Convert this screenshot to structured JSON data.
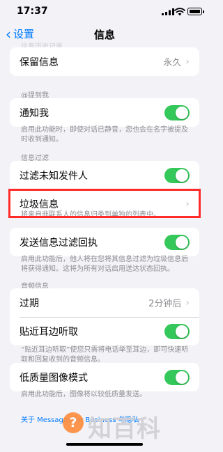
{
  "status": {
    "time": "17:37"
  },
  "nav": {
    "back": "设置",
    "title": "信息"
  },
  "top_cut_header": "信息历史记录",
  "history": {
    "keep": {
      "label": "保留信息",
      "value": "永久"
    }
  },
  "mentions": {
    "header": "@提到我",
    "notify": {
      "label": "通知我",
      "on": true
    },
    "note": "启用此功能时，即使对话已静音，您也会在名字被提及时收到通知。"
  },
  "filtering": {
    "header": "信息过滤",
    "unknown": {
      "label": "过滤未知发件人",
      "on": true
    },
    "junk": {
      "label": "垃圾信息"
    },
    "note": "将来自非联系人的信息归类到单独的列表中。"
  },
  "receipts": {
    "send": {
      "label": "发送信息过滤回执",
      "on": true
    },
    "note": "启用此功能后，他人将在您将其信息过滤为垃圾信息后将获得通知。这将为所有对话启用送达状态回执。"
  },
  "audio": {
    "header": "音频信息",
    "expire": {
      "label": "过期",
      "value": "2分钟后"
    },
    "raise": {
      "label": "贴近耳边听取",
      "on": true
    },
    "note": "“贴近耳边听取”使您只需将电话举至耳边，即可快速听取和回复收到的音频信息。"
  },
  "lowquality": {
    "label": "低质量图像模式",
    "on": true,
    "note": "启用此功能后，图像将以较低质量发送。"
  },
  "footer_link": "关于 Messages for Business 与隐私",
  "watermark": {
    "icon_char": "?",
    "text": "知百科"
  },
  "colors": {
    "accent": "#007aff",
    "toggle_on": "#34c759",
    "highlight": "#ff2b2b"
  }
}
